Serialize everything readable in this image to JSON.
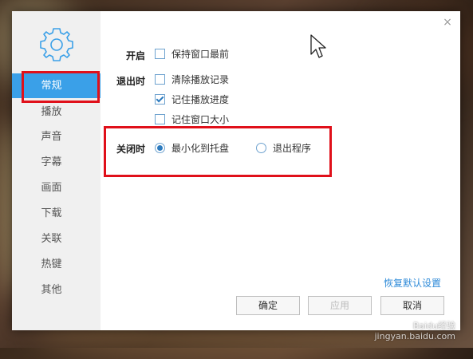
{
  "dialog": {
    "close_label": "×"
  },
  "sidebar": {
    "icon": "gear-icon",
    "items": [
      {
        "label": "常规",
        "active": true
      },
      {
        "label": "播放"
      },
      {
        "label": "声音"
      },
      {
        "label": "字幕"
      },
      {
        "label": "画面"
      },
      {
        "label": "下载"
      },
      {
        "label": "关联"
      },
      {
        "label": "热键"
      },
      {
        "label": "其他"
      }
    ]
  },
  "settings": {
    "startup": {
      "label": "开启",
      "options": [
        {
          "label": "保持窗口最前",
          "checked": false
        }
      ]
    },
    "on_exit": {
      "label": "退出时",
      "options": [
        {
          "label": "清除播放记录",
          "checked": false
        },
        {
          "label": "记住播放进度",
          "checked": true
        },
        {
          "label": "记住窗口大小",
          "checked": false
        }
      ]
    },
    "on_close": {
      "label": "关闭时",
      "options": [
        {
          "label": "最小化到托盘",
          "selected": true
        },
        {
          "label": "退出程序",
          "selected": false
        }
      ]
    }
  },
  "footer": {
    "restore_defaults": "恢复默认设置",
    "ok": "确定",
    "apply": "应用",
    "cancel": "取消"
  },
  "watermark": {
    "line1": "Baidu经验",
    "line2": "jingyan.baidu.com"
  },
  "colors": {
    "accent": "#3aa0e8",
    "highlight_box": "#e0101a"
  }
}
